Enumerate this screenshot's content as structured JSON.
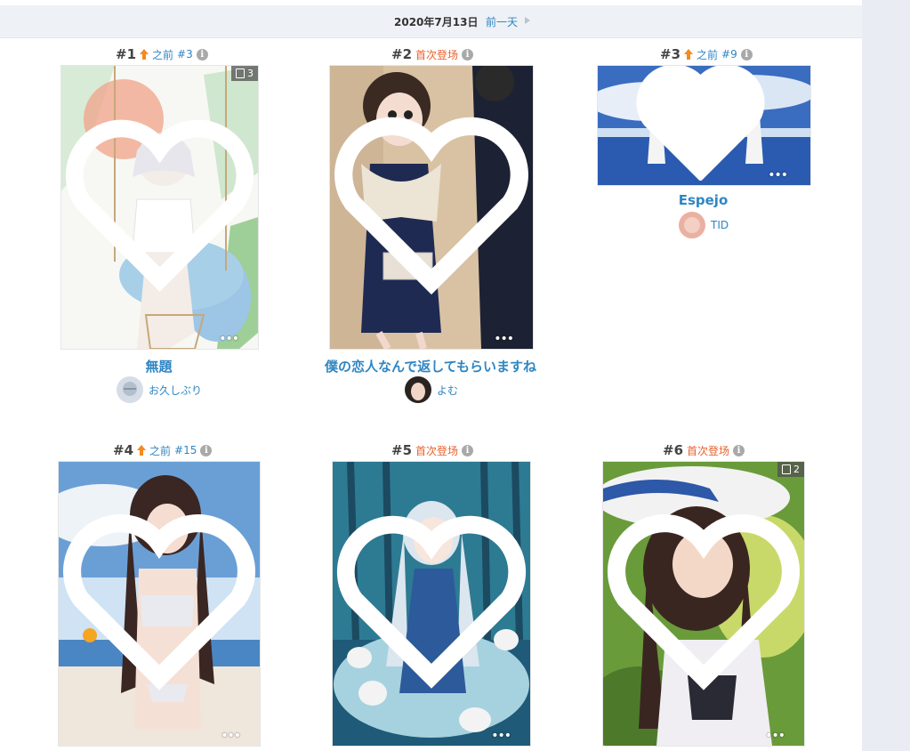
{
  "date_bar": {
    "date": "2020年7月13日",
    "prev_label": "前一天"
  },
  "items": [
    {
      "rank": "#1",
      "change": "up",
      "change_label": "之前",
      "prev_rank": "#3",
      "pages": "3",
      "title": "無題",
      "author": "お久しぶり"
    },
    {
      "rank": "#2",
      "change": "new",
      "change_label": "首次登场",
      "title": "僕の恋人なんで返してもらいますね",
      "author": "よむ"
    },
    {
      "rank": "#3",
      "change": "up",
      "change_label": "之前",
      "prev_rank": "#9",
      "title": "Espejo",
      "author": "TID"
    },
    {
      "rank": "#4",
      "change": "up",
      "change_label": "之前",
      "prev_rank": "#15"
    },
    {
      "rank": "#5",
      "change": "new",
      "change_label": "首次登场"
    },
    {
      "rank": "#6",
      "change": "new",
      "change_label": "首次登场",
      "pages": "2"
    }
  ],
  "colors": {
    "link": "#2f86c3",
    "new": "#e8612c",
    "up_arrow": "#f58a1f"
  }
}
